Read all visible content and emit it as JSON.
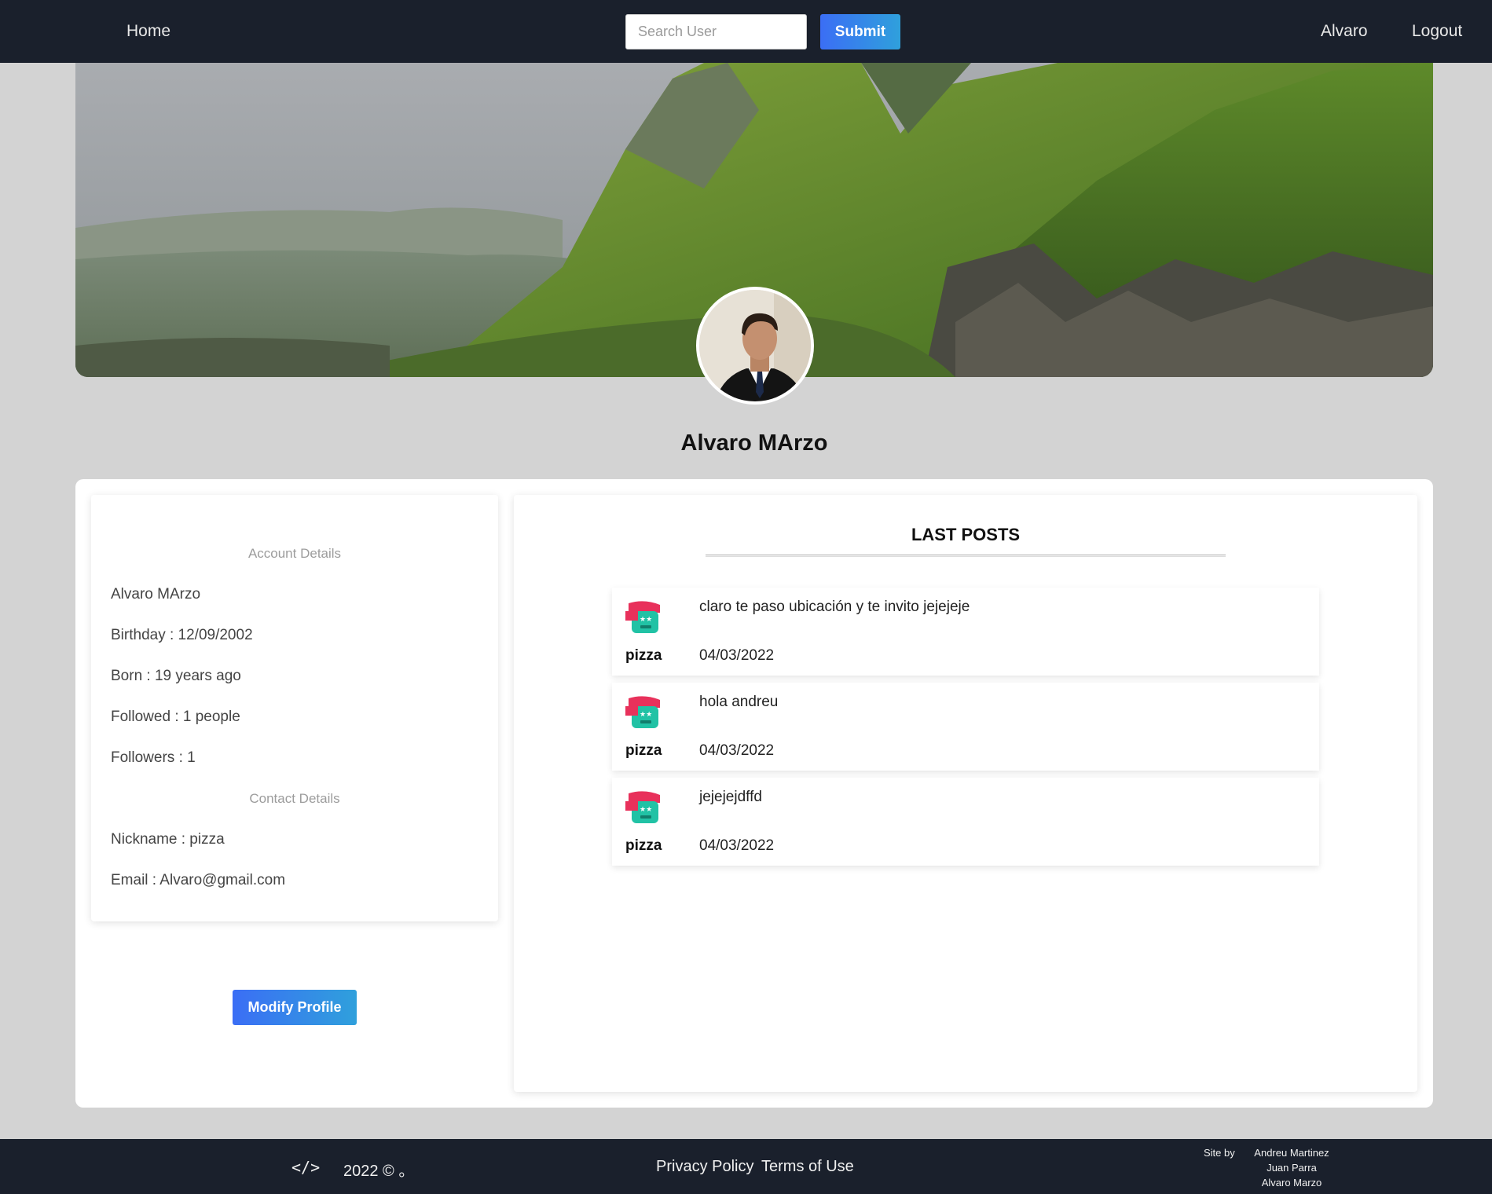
{
  "navbar": {
    "home_label": "Home",
    "search_placeholder": "Search User",
    "search_value": "",
    "submit_label": "Submit",
    "user_label": "Alvaro",
    "logout_label": "Logout"
  },
  "profile": {
    "name": "Alvaro MArzo"
  },
  "account_details": {
    "heading": "Account Details",
    "name": "Alvaro MArzo",
    "birthday": "Birthday : 12/09/2002",
    "born": "Born : 19 years ago",
    "followed": "Followed : 1 people",
    "followers": "Followers : 1"
  },
  "contact_details": {
    "heading": "Contact Details",
    "nickname": "Nickname : pizza",
    "email": "Email : Alvaro@gmail.com"
  },
  "modify_label": "Modify Profile",
  "posts": {
    "title": "LAST POSTS",
    "items": [
      {
        "text": "claro te paso ubicación y te invito jejejeje",
        "user": "pizza",
        "date": "04/03/2022"
      },
      {
        "text": "hola andreu",
        "user": "pizza",
        "date": "04/03/2022"
      },
      {
        "text": "jejejejdffd",
        "user": "pizza",
        "date": "04/03/2022"
      }
    ]
  },
  "footer": {
    "code_symbol": "</>",
    "copyright": "2022 © 。",
    "privacy": "Privacy Policy",
    "terms": "Terms of Use",
    "credits_label": "Site by",
    "credits": [
      "Andreu Martinez",
      "Juan Parra",
      "Alvaro Marzo"
    ]
  },
  "colors": {
    "navbar_bg": "#1a202c",
    "page_bg": "#d3d3d3",
    "button_gradient_start": "#3b6ef5",
    "button_gradient_end": "#2fa0dc",
    "avatar_icon_red": "#e8315b",
    "avatar_icon_teal": "#21c2a5"
  },
  "icons": [
    "code-icon",
    "post-avatar-icon",
    "profile-avatar",
    "cover-image"
  ]
}
